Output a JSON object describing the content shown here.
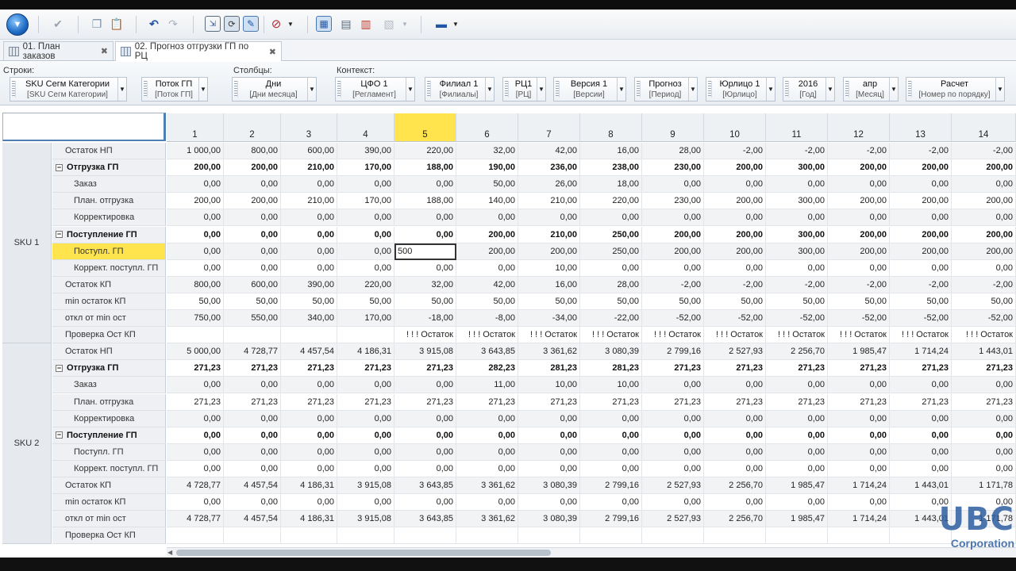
{
  "toolbar": {
    "icons": [
      "app-menu-orb",
      "checkmark-icon",
      "copy-icon",
      "paste-icon",
      "undo-icon",
      "redo-icon",
      "window-icon",
      "refresh-icon",
      "chart-edit-icon",
      "block-icon",
      "grid-view-icon",
      "table-view-icon",
      "bar-chart-icon",
      "export-icon",
      "tools-icon"
    ]
  },
  "tabs": [
    {
      "label": "01. План заказов",
      "active": false
    },
    {
      "label": "02. Прогноз отгрузки ГП по РЦ",
      "active": true
    }
  ],
  "filters": {
    "rows_label": "Строки:",
    "cols_label": "Столбцы:",
    "context_label": "Контекст:",
    "rows": [
      {
        "main": "SKU Сегм Категории",
        "sub": "[SKU Сегм Категории]"
      },
      {
        "main": "Поток ГП",
        "sub": "[Поток ГП]"
      }
    ],
    "cols": [
      {
        "main": "Дни",
        "sub": "[Дни месяца]"
      }
    ],
    "context": [
      {
        "main": "ЦФО 1",
        "sub": "[Регламент]"
      },
      {
        "main": "Филиал 1",
        "sub": "[Филиалы]"
      },
      {
        "main": "РЦ1",
        "sub": "[РЦ]"
      },
      {
        "main": "Версия 1",
        "sub": "[Версии]"
      },
      {
        "main": "Прогноз",
        "sub": "[Период]"
      },
      {
        "main": "Юрлицо 1",
        "sub": "[Юрлицо]"
      },
      {
        "main": "2016",
        "sub": "[Год]"
      },
      {
        "main": "апр",
        "sub": "[Месяц]"
      },
      {
        "main": "Расчет",
        "sub": "[Номер по порядку]"
      }
    ]
  },
  "grid": {
    "columns": [
      "1",
      "2",
      "3",
      "4",
      "5",
      "6",
      "7",
      "8",
      "9",
      "10",
      "11",
      "12",
      "13",
      "14"
    ],
    "selected_column": "5",
    "editing": {
      "sku": 0,
      "row": 6,
      "col": 4,
      "value": "500"
    },
    "skus": [
      {
        "name": "SKU 1",
        "rows": [
          {
            "label": "Остаток НП",
            "level": 1,
            "values": [
              "1 000,00",
              "800,00",
              "600,00",
              "390,00",
              "220,00",
              "32,00",
              "42,00",
              "16,00",
              "28,00",
              "-2,00",
              "-2,00",
              "-2,00",
              "-2,00",
              "-2,00"
            ]
          },
          {
            "label": "Отгрузка ГП",
            "level": 0,
            "bold": true,
            "values": [
              "200,00",
              "200,00",
              "210,00",
              "170,00",
              "188,00",
              "190,00",
              "236,00",
              "238,00",
              "230,00",
              "200,00",
              "300,00",
              "200,00",
              "200,00",
              "200,00"
            ]
          },
          {
            "label": "Заказ",
            "level": 2,
            "values": [
              "0,00",
              "0,00",
              "0,00",
              "0,00",
              "0,00",
              "50,00",
              "26,00",
              "18,00",
              "0,00",
              "0,00",
              "0,00",
              "0,00",
              "0,00",
              "0,00"
            ]
          },
          {
            "label": "План. отгрузка",
            "level": 2,
            "values": [
              "200,00",
              "200,00",
              "210,00",
              "170,00",
              "188,00",
              "140,00",
              "210,00",
              "220,00",
              "230,00",
              "200,00",
              "300,00",
              "200,00",
              "200,00",
              "200,00"
            ]
          },
          {
            "label": "Корректировка",
            "level": 2,
            "values": [
              "0,00",
              "0,00",
              "0,00",
              "0,00",
              "0,00",
              "0,00",
              "0,00",
              "0,00",
              "0,00",
              "0,00",
              "0,00",
              "0,00",
              "0,00",
              "0,00"
            ]
          },
          {
            "label": "Поступление ГП",
            "level": 0,
            "bold": true,
            "values": [
              "0,00",
              "0,00",
              "0,00",
              "0,00",
              "0,00",
              "200,00",
              "210,00",
              "250,00",
              "200,00",
              "200,00",
              "300,00",
              "200,00",
              "200,00",
              "200,00"
            ]
          },
          {
            "label": "Поступл. ГП",
            "level": 2,
            "highlight": true,
            "values": [
              "0,00",
              "0,00",
              "0,00",
              "0,00",
              "500",
              "200,00",
              "200,00",
              "250,00",
              "200,00",
              "200,00",
              "300,00",
              "200,00",
              "200,00",
              "200,00"
            ]
          },
          {
            "label": "Коррект. поступл. ГП",
            "level": 2,
            "values": [
              "0,00",
              "0,00",
              "0,00",
              "0,00",
              "0,00",
              "0,00",
              "10,00",
              "0,00",
              "0,00",
              "0,00",
              "0,00",
              "0,00",
              "0,00",
              "0,00"
            ]
          },
          {
            "label": "Остаток КП",
            "level": 1,
            "values": [
              "800,00",
              "600,00",
              "390,00",
              "220,00",
              "32,00",
              "42,00",
              "16,00",
              "28,00",
              "-2,00",
              "-2,00",
              "-2,00",
              "-2,00",
              "-2,00",
              "-2,00"
            ]
          },
          {
            "label": "min остаток КП",
            "level": 1,
            "values": [
              "50,00",
              "50,00",
              "50,00",
              "50,00",
              "50,00",
              "50,00",
              "50,00",
              "50,00",
              "50,00",
              "50,00",
              "50,00",
              "50,00",
              "50,00",
              "50,00"
            ]
          },
          {
            "label": "откл от min ост",
            "level": 1,
            "values": [
              "750,00",
              "550,00",
              "340,00",
              "170,00",
              "-18,00",
              "-8,00",
              "-34,00",
              "-22,00",
              "-52,00",
              "-52,00",
              "-52,00",
              "-52,00",
              "-52,00",
              "-52,00"
            ]
          },
          {
            "label": "Проверка Ост КП",
            "level": 1,
            "values": [
              "",
              "",
              "",
              "",
              "! ! ! Остаток",
              "! ! ! Остаток",
              "! ! ! Остаток",
              "! ! ! Остаток",
              "! ! ! Остаток",
              "! ! ! Остаток",
              "! ! ! Остаток",
              "! ! ! Остаток",
              "! ! ! Остаток",
              "! ! ! Остаток"
            ]
          }
        ]
      },
      {
        "name": "SKU 2",
        "rows": [
          {
            "label": "Остаток НП",
            "level": 1,
            "values": [
              "5 000,00",
              "4 728,77",
              "4 457,54",
              "4 186,31",
              "3 915,08",
              "3 643,85",
              "3 361,62",
              "3 080,39",
              "2 799,16",
              "2 527,93",
              "2 256,70",
              "1 985,47",
              "1 714,24",
              "1 443,01"
            ]
          },
          {
            "label": "Отгрузка ГП",
            "level": 0,
            "bold": true,
            "values": [
              "271,23",
              "271,23",
              "271,23",
              "271,23",
              "271,23",
              "282,23",
              "281,23",
              "281,23",
              "271,23",
              "271,23",
              "271,23",
              "271,23",
              "271,23",
              "271,23"
            ]
          },
          {
            "label": "Заказ",
            "level": 2,
            "values": [
              "0,00",
              "0,00",
              "0,00",
              "0,00",
              "0,00",
              "11,00",
              "10,00",
              "10,00",
              "0,00",
              "0,00",
              "0,00",
              "0,00",
              "0,00",
              "0,00"
            ]
          },
          {
            "label": "План. отгрузка",
            "level": 2,
            "values": [
              "271,23",
              "271,23",
              "271,23",
              "271,23",
              "271,23",
              "271,23",
              "271,23",
              "271,23",
              "271,23",
              "271,23",
              "271,23",
              "271,23",
              "271,23",
              "271,23"
            ]
          },
          {
            "label": "Корректировка",
            "level": 2,
            "values": [
              "0,00",
              "0,00",
              "0,00",
              "0,00",
              "0,00",
              "0,00",
              "0,00",
              "0,00",
              "0,00",
              "0,00",
              "0,00",
              "0,00",
              "0,00",
              "0,00"
            ]
          },
          {
            "label": "Поступление ГП",
            "level": 0,
            "bold": true,
            "values": [
              "0,00",
              "0,00",
              "0,00",
              "0,00",
              "0,00",
              "0,00",
              "0,00",
              "0,00",
              "0,00",
              "0,00",
              "0,00",
              "0,00",
              "0,00",
              "0,00"
            ]
          },
          {
            "label": "Поступл. ГП",
            "level": 2,
            "values": [
              "0,00",
              "0,00",
              "0,00",
              "0,00",
              "0,00",
              "0,00",
              "0,00",
              "0,00",
              "0,00",
              "0,00",
              "0,00",
              "0,00",
              "0,00",
              "0,00"
            ]
          },
          {
            "label": "Коррект. поступл. ГП",
            "level": 2,
            "values": [
              "0,00",
              "0,00",
              "0,00",
              "0,00",
              "0,00",
              "0,00",
              "0,00",
              "0,00",
              "0,00",
              "0,00",
              "0,00",
              "0,00",
              "0,00",
              "0,00"
            ]
          },
          {
            "label": "Остаток КП",
            "level": 1,
            "values": [
              "4 728,77",
              "4 457,54",
              "4 186,31",
              "3 915,08",
              "3 643,85",
              "3 361,62",
              "3 080,39",
              "2 799,16",
              "2 527,93",
              "2 256,70",
              "1 985,47",
              "1 714,24",
              "1 443,01",
              "1 171,78"
            ]
          },
          {
            "label": "min остаток КП",
            "level": 1,
            "values": [
              "0,00",
              "0,00",
              "0,00",
              "0,00",
              "0,00",
              "0,00",
              "0,00",
              "0,00",
              "0,00",
              "0,00",
              "0,00",
              "0,00",
              "0,00",
              "0,00"
            ]
          },
          {
            "label": "откл от min ост",
            "level": 1,
            "values": [
              "4 728,77",
              "4 457,54",
              "4 186,31",
              "3 915,08",
              "3 643,85",
              "3 361,62",
              "3 080,39",
              "2 799,16",
              "2 527,93",
              "2 256,70",
              "1 985,47",
              "1 714,24",
              "1 443,01",
              "1 171,78"
            ]
          },
          {
            "label": "Проверка Ост КП",
            "level": 1,
            "values": [
              "",
              "",
              "",
              "",
              "",
              "",
              "",
              "",
              "",
              "",
              "",
              "",
              "",
              ""
            ]
          }
        ]
      }
    ]
  },
  "watermark": {
    "line1": "UBC",
    "line2": "Corporation"
  },
  "colors": {
    "selection": "#ffe44d",
    "accent": "#4f7fb3"
  }
}
